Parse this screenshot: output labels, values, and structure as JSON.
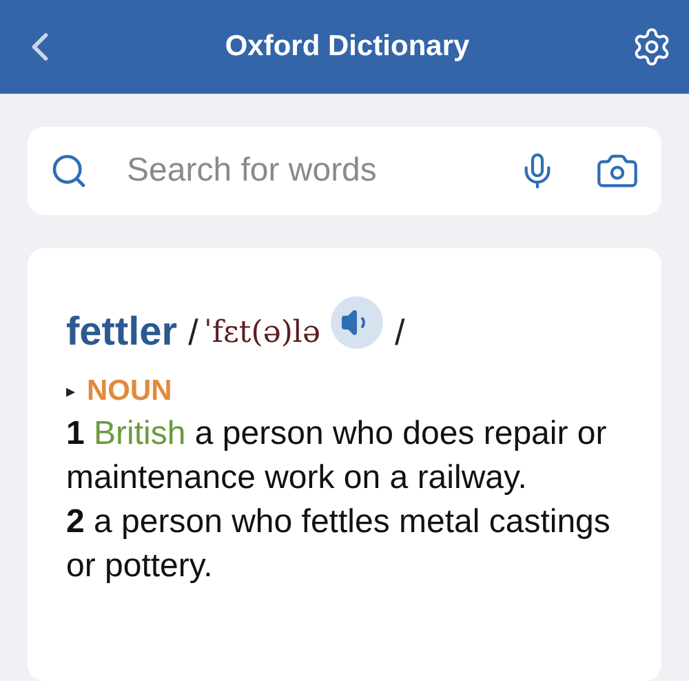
{
  "header": {
    "title": "Oxford Dictionary"
  },
  "search": {
    "placeholder": "Search for words"
  },
  "entry": {
    "headword": "fettler",
    "slash_open": "/",
    "pronunciation": "ˈfɛt(ə)lə",
    "slash_close": "/",
    "part_of_speech_marker": "▸",
    "part_of_speech": "NOUN",
    "senses": [
      {
        "number": "1",
        "label": "British",
        "text": "a person who does repair or maintenance work on a railway."
      },
      {
        "number": "2",
        "text": "a person who fettles metal castings or pottery."
      }
    ]
  }
}
